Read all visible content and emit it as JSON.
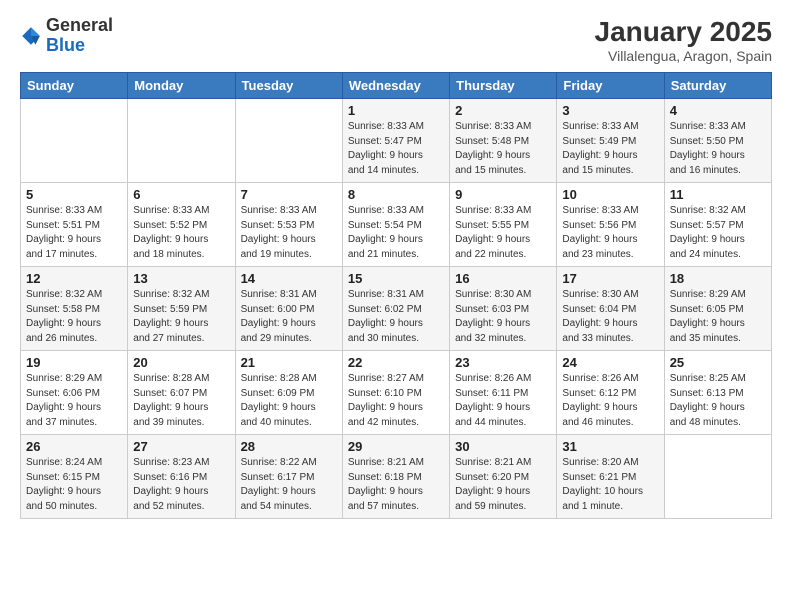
{
  "logo": {
    "general": "General",
    "blue": "Blue"
  },
  "title": "January 2025",
  "subtitle": "Villalengua, Aragon, Spain",
  "days_of_week": [
    "Sunday",
    "Monday",
    "Tuesday",
    "Wednesday",
    "Thursday",
    "Friday",
    "Saturday"
  ],
  "weeks": [
    [
      {
        "num": "",
        "info": ""
      },
      {
        "num": "",
        "info": ""
      },
      {
        "num": "",
        "info": ""
      },
      {
        "num": "1",
        "info": "Sunrise: 8:33 AM\nSunset: 5:47 PM\nDaylight: 9 hours\nand 14 minutes."
      },
      {
        "num": "2",
        "info": "Sunrise: 8:33 AM\nSunset: 5:48 PM\nDaylight: 9 hours\nand 15 minutes."
      },
      {
        "num": "3",
        "info": "Sunrise: 8:33 AM\nSunset: 5:49 PM\nDaylight: 9 hours\nand 15 minutes."
      },
      {
        "num": "4",
        "info": "Sunrise: 8:33 AM\nSunset: 5:50 PM\nDaylight: 9 hours\nand 16 minutes."
      }
    ],
    [
      {
        "num": "5",
        "info": "Sunrise: 8:33 AM\nSunset: 5:51 PM\nDaylight: 9 hours\nand 17 minutes."
      },
      {
        "num": "6",
        "info": "Sunrise: 8:33 AM\nSunset: 5:52 PM\nDaylight: 9 hours\nand 18 minutes."
      },
      {
        "num": "7",
        "info": "Sunrise: 8:33 AM\nSunset: 5:53 PM\nDaylight: 9 hours\nand 19 minutes."
      },
      {
        "num": "8",
        "info": "Sunrise: 8:33 AM\nSunset: 5:54 PM\nDaylight: 9 hours\nand 21 minutes."
      },
      {
        "num": "9",
        "info": "Sunrise: 8:33 AM\nSunset: 5:55 PM\nDaylight: 9 hours\nand 22 minutes."
      },
      {
        "num": "10",
        "info": "Sunrise: 8:33 AM\nSunset: 5:56 PM\nDaylight: 9 hours\nand 23 minutes."
      },
      {
        "num": "11",
        "info": "Sunrise: 8:32 AM\nSunset: 5:57 PM\nDaylight: 9 hours\nand 24 minutes."
      }
    ],
    [
      {
        "num": "12",
        "info": "Sunrise: 8:32 AM\nSunset: 5:58 PM\nDaylight: 9 hours\nand 26 minutes."
      },
      {
        "num": "13",
        "info": "Sunrise: 8:32 AM\nSunset: 5:59 PM\nDaylight: 9 hours\nand 27 minutes."
      },
      {
        "num": "14",
        "info": "Sunrise: 8:31 AM\nSunset: 6:00 PM\nDaylight: 9 hours\nand 29 minutes."
      },
      {
        "num": "15",
        "info": "Sunrise: 8:31 AM\nSunset: 6:02 PM\nDaylight: 9 hours\nand 30 minutes."
      },
      {
        "num": "16",
        "info": "Sunrise: 8:30 AM\nSunset: 6:03 PM\nDaylight: 9 hours\nand 32 minutes."
      },
      {
        "num": "17",
        "info": "Sunrise: 8:30 AM\nSunset: 6:04 PM\nDaylight: 9 hours\nand 33 minutes."
      },
      {
        "num": "18",
        "info": "Sunrise: 8:29 AM\nSunset: 6:05 PM\nDaylight: 9 hours\nand 35 minutes."
      }
    ],
    [
      {
        "num": "19",
        "info": "Sunrise: 8:29 AM\nSunset: 6:06 PM\nDaylight: 9 hours\nand 37 minutes."
      },
      {
        "num": "20",
        "info": "Sunrise: 8:28 AM\nSunset: 6:07 PM\nDaylight: 9 hours\nand 39 minutes."
      },
      {
        "num": "21",
        "info": "Sunrise: 8:28 AM\nSunset: 6:09 PM\nDaylight: 9 hours\nand 40 minutes."
      },
      {
        "num": "22",
        "info": "Sunrise: 8:27 AM\nSunset: 6:10 PM\nDaylight: 9 hours\nand 42 minutes."
      },
      {
        "num": "23",
        "info": "Sunrise: 8:26 AM\nSunset: 6:11 PM\nDaylight: 9 hours\nand 44 minutes."
      },
      {
        "num": "24",
        "info": "Sunrise: 8:26 AM\nSunset: 6:12 PM\nDaylight: 9 hours\nand 46 minutes."
      },
      {
        "num": "25",
        "info": "Sunrise: 8:25 AM\nSunset: 6:13 PM\nDaylight: 9 hours\nand 48 minutes."
      }
    ],
    [
      {
        "num": "26",
        "info": "Sunrise: 8:24 AM\nSunset: 6:15 PM\nDaylight: 9 hours\nand 50 minutes."
      },
      {
        "num": "27",
        "info": "Sunrise: 8:23 AM\nSunset: 6:16 PM\nDaylight: 9 hours\nand 52 minutes."
      },
      {
        "num": "28",
        "info": "Sunrise: 8:22 AM\nSunset: 6:17 PM\nDaylight: 9 hours\nand 54 minutes."
      },
      {
        "num": "29",
        "info": "Sunrise: 8:21 AM\nSunset: 6:18 PM\nDaylight: 9 hours\nand 57 minutes."
      },
      {
        "num": "30",
        "info": "Sunrise: 8:21 AM\nSunset: 6:20 PM\nDaylight: 9 hours\nand 59 minutes."
      },
      {
        "num": "31",
        "info": "Sunrise: 8:20 AM\nSunset: 6:21 PM\nDaylight: 10 hours\nand 1 minute."
      },
      {
        "num": "",
        "info": ""
      }
    ]
  ]
}
